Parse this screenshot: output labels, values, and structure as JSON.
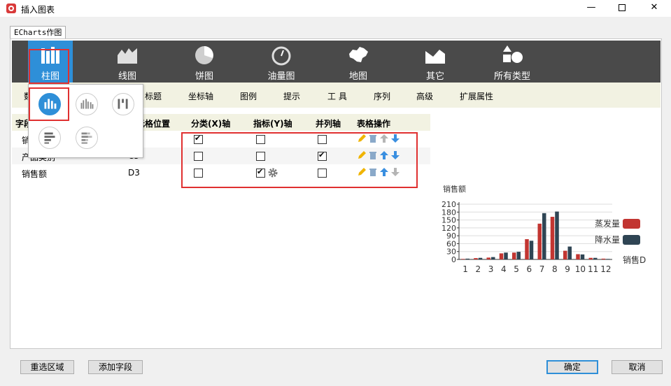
{
  "window": {
    "title": "插入图表"
  },
  "tab": {
    "label": "ECharts作图"
  },
  "chart_types": [
    {
      "label": "柱图",
      "icon": "bar-chart-icon",
      "active": true
    },
    {
      "label": "线图",
      "icon": "area-chart-icon",
      "active": false
    },
    {
      "label": "饼图",
      "icon": "pie-chart-icon",
      "active": false
    },
    {
      "label": "油量图",
      "icon": "gauge-icon",
      "active": false
    },
    {
      "label": "地图",
      "icon": "china-map-icon",
      "active": false
    },
    {
      "label": "其它",
      "icon": "other-chart-icon",
      "active": false
    },
    {
      "label": "所有类型",
      "icon": "shapes-icon",
      "active": false
    }
  ],
  "subtabs": [
    "数",
    "标题",
    "坐标轴",
    "图例",
    "提示",
    "工 具",
    "序列",
    "高级",
    "扩展属性"
  ],
  "table": {
    "headers": [
      "字段",
      "单元格位置",
      "分类(X)轴",
      "指标(Y)轴",
      "并列轴",
      "表格操作"
    ],
    "rows": [
      {
        "field": "销",
        "cell": "",
        "x": true,
        "y": false,
        "parallel": false
      },
      {
        "field": "产品类别",
        "cell": "C3",
        "x": false,
        "y": false,
        "parallel": true
      },
      {
        "field": "销售额",
        "cell": "D3",
        "x": false,
        "y": true,
        "parallel": false
      }
    ]
  },
  "chart_data": {
    "type": "bar",
    "title": "销售额",
    "categories": [
      "1",
      "2",
      "3",
      "4",
      "5",
      "6",
      "7",
      "8",
      "9",
      "10",
      "11",
      "12"
    ],
    "series": [
      {
        "name": "蒸发量",
        "color": "#c23531",
        "values": [
          2,
          5,
          7,
          23,
          26,
          77,
          136,
          162,
          33,
          20,
          6,
          3
        ]
      },
      {
        "name": "降水量",
        "color": "#2f4554",
        "values": [
          3,
          6,
          9,
          26,
          29,
          71,
          176,
          182,
          49,
          19,
          6,
          2
        ]
      }
    ],
    "ylim": [
      0,
      210
    ],
    "yticks": [
      0,
      30,
      60,
      90,
      120,
      150,
      180,
      210
    ],
    "legend_extra": "销售D",
    "grid": true,
    "legend": "right"
  },
  "buttons": {
    "reselect": "重选区域",
    "add_field": "添加字段",
    "ok": "确定",
    "cancel": "取消"
  }
}
